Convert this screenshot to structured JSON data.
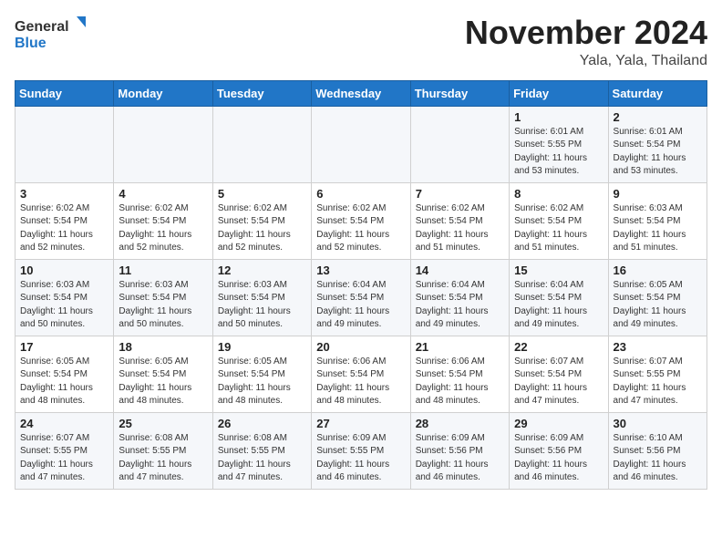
{
  "header": {
    "logo_line1": "General",
    "logo_line2": "Blue",
    "month_title": "November 2024",
    "location": "Yala, Yala, Thailand"
  },
  "days_of_week": [
    "Sunday",
    "Monday",
    "Tuesday",
    "Wednesday",
    "Thursday",
    "Friday",
    "Saturday"
  ],
  "weeks": [
    [
      {
        "day": "",
        "info": ""
      },
      {
        "day": "",
        "info": ""
      },
      {
        "day": "",
        "info": ""
      },
      {
        "day": "",
        "info": ""
      },
      {
        "day": "",
        "info": ""
      },
      {
        "day": "1",
        "info": "Sunrise: 6:01 AM\nSunset: 5:55 PM\nDaylight: 11 hours\nand 53 minutes."
      },
      {
        "day": "2",
        "info": "Sunrise: 6:01 AM\nSunset: 5:54 PM\nDaylight: 11 hours\nand 53 minutes."
      }
    ],
    [
      {
        "day": "3",
        "info": "Sunrise: 6:02 AM\nSunset: 5:54 PM\nDaylight: 11 hours\nand 52 minutes."
      },
      {
        "day": "4",
        "info": "Sunrise: 6:02 AM\nSunset: 5:54 PM\nDaylight: 11 hours\nand 52 minutes."
      },
      {
        "day": "5",
        "info": "Sunrise: 6:02 AM\nSunset: 5:54 PM\nDaylight: 11 hours\nand 52 minutes."
      },
      {
        "day": "6",
        "info": "Sunrise: 6:02 AM\nSunset: 5:54 PM\nDaylight: 11 hours\nand 52 minutes."
      },
      {
        "day": "7",
        "info": "Sunrise: 6:02 AM\nSunset: 5:54 PM\nDaylight: 11 hours\nand 51 minutes."
      },
      {
        "day": "8",
        "info": "Sunrise: 6:02 AM\nSunset: 5:54 PM\nDaylight: 11 hours\nand 51 minutes."
      },
      {
        "day": "9",
        "info": "Sunrise: 6:03 AM\nSunset: 5:54 PM\nDaylight: 11 hours\nand 51 minutes."
      }
    ],
    [
      {
        "day": "10",
        "info": "Sunrise: 6:03 AM\nSunset: 5:54 PM\nDaylight: 11 hours\nand 50 minutes."
      },
      {
        "day": "11",
        "info": "Sunrise: 6:03 AM\nSunset: 5:54 PM\nDaylight: 11 hours\nand 50 minutes."
      },
      {
        "day": "12",
        "info": "Sunrise: 6:03 AM\nSunset: 5:54 PM\nDaylight: 11 hours\nand 50 minutes."
      },
      {
        "day": "13",
        "info": "Sunrise: 6:04 AM\nSunset: 5:54 PM\nDaylight: 11 hours\nand 49 minutes."
      },
      {
        "day": "14",
        "info": "Sunrise: 6:04 AM\nSunset: 5:54 PM\nDaylight: 11 hours\nand 49 minutes."
      },
      {
        "day": "15",
        "info": "Sunrise: 6:04 AM\nSunset: 5:54 PM\nDaylight: 11 hours\nand 49 minutes."
      },
      {
        "day": "16",
        "info": "Sunrise: 6:05 AM\nSunset: 5:54 PM\nDaylight: 11 hours\nand 49 minutes."
      }
    ],
    [
      {
        "day": "17",
        "info": "Sunrise: 6:05 AM\nSunset: 5:54 PM\nDaylight: 11 hours\nand 48 minutes."
      },
      {
        "day": "18",
        "info": "Sunrise: 6:05 AM\nSunset: 5:54 PM\nDaylight: 11 hours\nand 48 minutes."
      },
      {
        "day": "19",
        "info": "Sunrise: 6:05 AM\nSunset: 5:54 PM\nDaylight: 11 hours\nand 48 minutes."
      },
      {
        "day": "20",
        "info": "Sunrise: 6:06 AM\nSunset: 5:54 PM\nDaylight: 11 hours\nand 48 minutes."
      },
      {
        "day": "21",
        "info": "Sunrise: 6:06 AM\nSunset: 5:54 PM\nDaylight: 11 hours\nand 48 minutes."
      },
      {
        "day": "22",
        "info": "Sunrise: 6:07 AM\nSunset: 5:54 PM\nDaylight: 11 hours\nand 47 minutes."
      },
      {
        "day": "23",
        "info": "Sunrise: 6:07 AM\nSunset: 5:55 PM\nDaylight: 11 hours\nand 47 minutes."
      }
    ],
    [
      {
        "day": "24",
        "info": "Sunrise: 6:07 AM\nSunset: 5:55 PM\nDaylight: 11 hours\nand 47 minutes."
      },
      {
        "day": "25",
        "info": "Sunrise: 6:08 AM\nSunset: 5:55 PM\nDaylight: 11 hours\nand 47 minutes."
      },
      {
        "day": "26",
        "info": "Sunrise: 6:08 AM\nSunset: 5:55 PM\nDaylight: 11 hours\nand 47 minutes."
      },
      {
        "day": "27",
        "info": "Sunrise: 6:09 AM\nSunset: 5:55 PM\nDaylight: 11 hours\nand 46 minutes."
      },
      {
        "day": "28",
        "info": "Sunrise: 6:09 AM\nSunset: 5:56 PM\nDaylight: 11 hours\nand 46 minutes."
      },
      {
        "day": "29",
        "info": "Sunrise: 6:09 AM\nSunset: 5:56 PM\nDaylight: 11 hours\nand 46 minutes."
      },
      {
        "day": "30",
        "info": "Sunrise: 6:10 AM\nSunset: 5:56 PM\nDaylight: 11 hours\nand 46 minutes."
      }
    ]
  ]
}
